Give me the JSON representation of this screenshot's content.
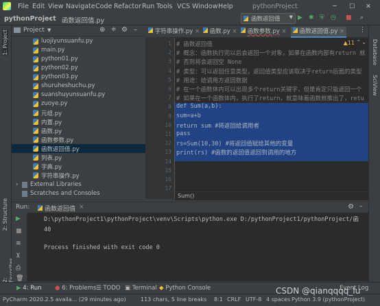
{
  "menu": [
    "File",
    "Edit",
    "View",
    "Navigate",
    "Code",
    "Refactor",
    "Run",
    "Tools",
    "VCS",
    "Window",
    "Help"
  ],
  "window_title": "pythonProject",
  "breadcrumb": {
    "project": "pythonProject",
    "file": "函数返回值.py"
  },
  "run_config": "函数返回值",
  "project_panel": {
    "title": "Project",
    "items": [
      {
        "label": "luojiyunsuanfu.py",
        "selected": false
      },
      {
        "label": "main.py",
        "selected": false
      },
      {
        "label": "python01.py",
        "selected": false
      },
      {
        "label": "python02.py",
        "selected": false
      },
      {
        "label": "python03.py",
        "selected": false
      },
      {
        "label": "shuruheshuchu.py",
        "selected": false
      },
      {
        "label": "suanshuyunsuanfu.py",
        "selected": false
      },
      {
        "label": "zuoye.py",
        "selected": false
      },
      {
        "label": "元组.py",
        "selected": false
      },
      {
        "label": "内置.py",
        "selected": false
      },
      {
        "label": "函数.py",
        "selected": false
      },
      {
        "label": "函数参数.py",
        "selected": false
      },
      {
        "label": "函数返回值.py",
        "selected": true
      },
      {
        "label": "列表.py",
        "selected": false
      },
      {
        "label": "字典.py",
        "selected": false
      },
      {
        "label": "字符串操作.py",
        "selected": false
      }
    ],
    "external_libraries": "External Libraries",
    "scratches": "Scratches and Consoles"
  },
  "editor_tabs": [
    {
      "label": "字符串操作.py",
      "active": false
    },
    {
      "label": "函数.py",
      "active": false
    },
    {
      "label": "函数参数.py",
      "active": false
    },
    {
      "label": "函数返回值.py",
      "active": true
    }
  ],
  "warning_count": "▲11",
  "line_numbers": [
    "1",
    "2",
    "3",
    "4",
    "5",
    "6",
    "7",
    "8",
    "9",
    "10",
    "11",
    "12",
    "13",
    "14",
    "15",
    "16",
    "17",
    "18"
  ],
  "code_lines": [
    "# 函数返回值",
    "# 概念：函数执行完以后会返回一个对象，如果在函数内部有return 就",
    "# 否则将会返回空 None",
    "# 类型：可以返回任意类型，返回值类型应该取决于return后面的类型",
    "# 用途：给调用方返回数据",
    "# 在一个函数体内可以出现多个return关键字，但是肯定只能返回一个",
    "# 如果在一个函数体内，执行了return，就意味着函数就推出了，retu",
    "def Sum(a,b):",
    "    sum=a+b",
    "    return sum #将返回给调用者",
    "    pass",
    "rs=Sum(10,30)  #将返回值赋给其他的变量",
    "print(rs)  #函数的返回值返回到调用的地方"
  ],
  "editor_breadcrumb": "Sum()",
  "right_strip": [
    "Database",
    "SciView"
  ],
  "left_strip": [
    "1: Project",
    "2: Structure",
    "2: Favorites"
  ],
  "run_panel": {
    "title": "Run:",
    "tab": "函数返回值",
    "lines": [
      "D:\\pythonProject1\\pythonProject\\venv\\Scripts\\python.exe D:/pythonProject1/pythonProject/函",
      "40",
      "",
      "Process finished with exit code 0"
    ]
  },
  "bottom_tabs": [
    "4: Run",
    "6: Problems",
    "TODO",
    "Terminal",
    "Python Console"
  ],
  "event_log": "Event Log",
  "status": {
    "message": "PyCharm 2020.2.5 availa... (29 minutes ago)",
    "chars": "113 chars, 5 line breaks",
    "pos": "8:1",
    "crlf": "CRLF",
    "enc": "UTF-8",
    "indent": "4 spaces",
    "python": "Python 3.9 (pythonProject)"
  },
  "watermark": "CSDN @qianqqqq_lu",
  "colors": {
    "bg": "#3c3f41",
    "editor": "#2b2b2b",
    "selection": "#214283",
    "accent": "#4a88c7"
  }
}
